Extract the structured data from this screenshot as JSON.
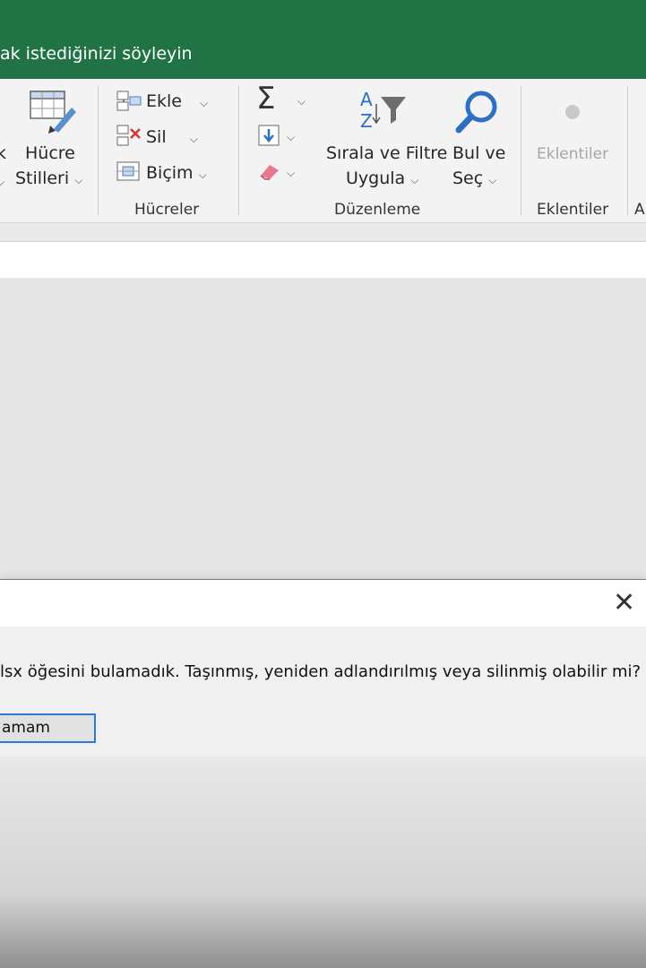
{
  "title_bar": {
    "tell_me_text": "ak istediğinizi söyleyin"
  },
  "ribbon": {
    "styles_group": {
      "left_partial_label": "k",
      "cell_styles_line1": "Hücre",
      "cell_styles_line2": "Stilleri"
    },
    "cells_group": {
      "insert": "Ekle",
      "delete": "Sil",
      "format": "Biçim",
      "group_label": "Hücreler"
    },
    "editing_group": {
      "sort_filter_line1": "Sırala ve Filtre",
      "sort_filter_line2": "Uygula",
      "find_select_line1": "Bul ve",
      "find_select_line2": "Seç",
      "group_label": "Düzenleme"
    },
    "addins_group": {
      "addins_button": "Eklentiler",
      "group_label": "Eklentiler",
      "next_group_partial": "A"
    }
  },
  "dialog": {
    "message": "lsx öğesini bulamadık. Taşınmış, yeniden adlandırılmış veya silinmiş olabilir mi?",
    "ok_label": "amam"
  },
  "colors": {
    "excel_green": "#217346",
    "ribbon_bg": "#f3f3f3",
    "focus_blue": "#2e7bd4"
  },
  "icons": [
    "cell-styles-icon",
    "insert-cells-icon",
    "delete-cells-icon",
    "format-cells-icon",
    "autosum-icon",
    "fill-icon",
    "clear-icon",
    "sort-filter-icon",
    "find-icon",
    "addins-icon",
    "close-icon"
  ]
}
